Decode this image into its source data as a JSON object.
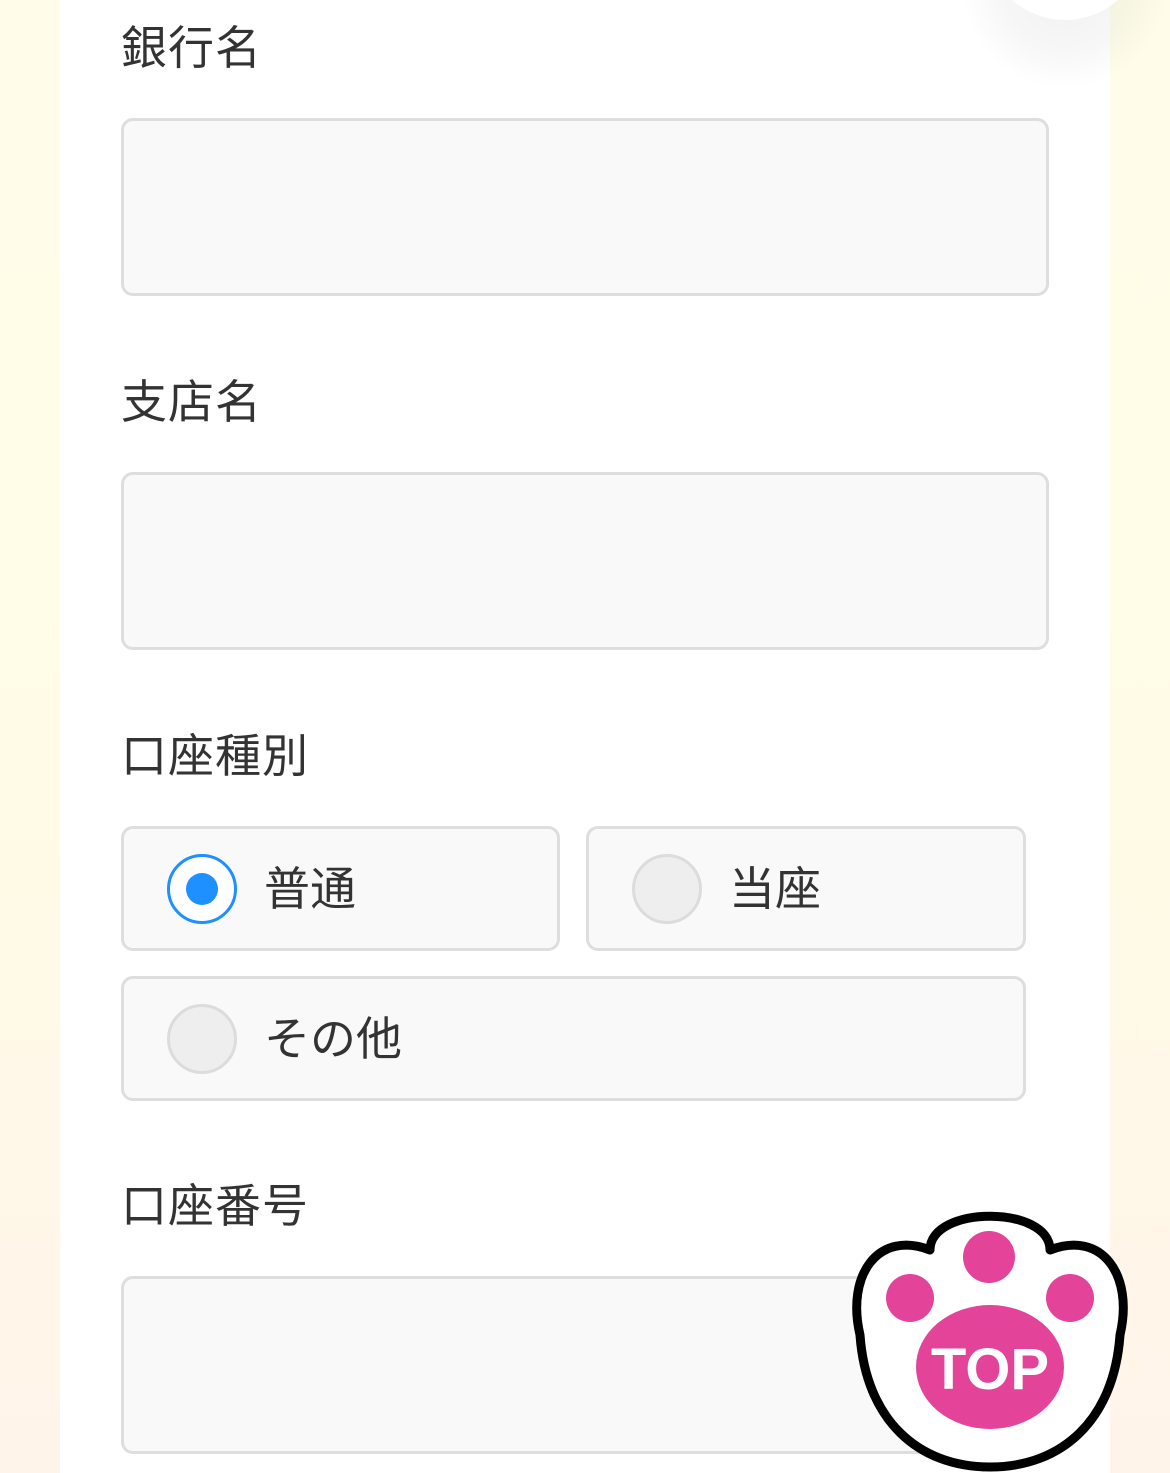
{
  "form": {
    "bank_name": {
      "label": "銀行名",
      "value": "",
      "placeholder": ""
    },
    "branch_name": {
      "label": "支店名",
      "value": "",
      "placeholder": ""
    },
    "account_type": {
      "label": "口座種別",
      "options": [
        {
          "label": "普通",
          "checked": true
        },
        {
          "label": "当座",
          "checked": false
        },
        {
          "label": "その他",
          "checked": false
        }
      ]
    },
    "account_number": {
      "label": "口座番号",
      "value": "",
      "placeholder": ""
    }
  },
  "scroll_top": {
    "label": "TOP",
    "icon": "paw-icon",
    "color": "#e3449a"
  },
  "colors": {
    "accent": "#1e90ff",
    "field_bg": "#f9f9f9",
    "field_border": "#dedede",
    "text": "#333333",
    "page_bg": "#fffdea"
  }
}
